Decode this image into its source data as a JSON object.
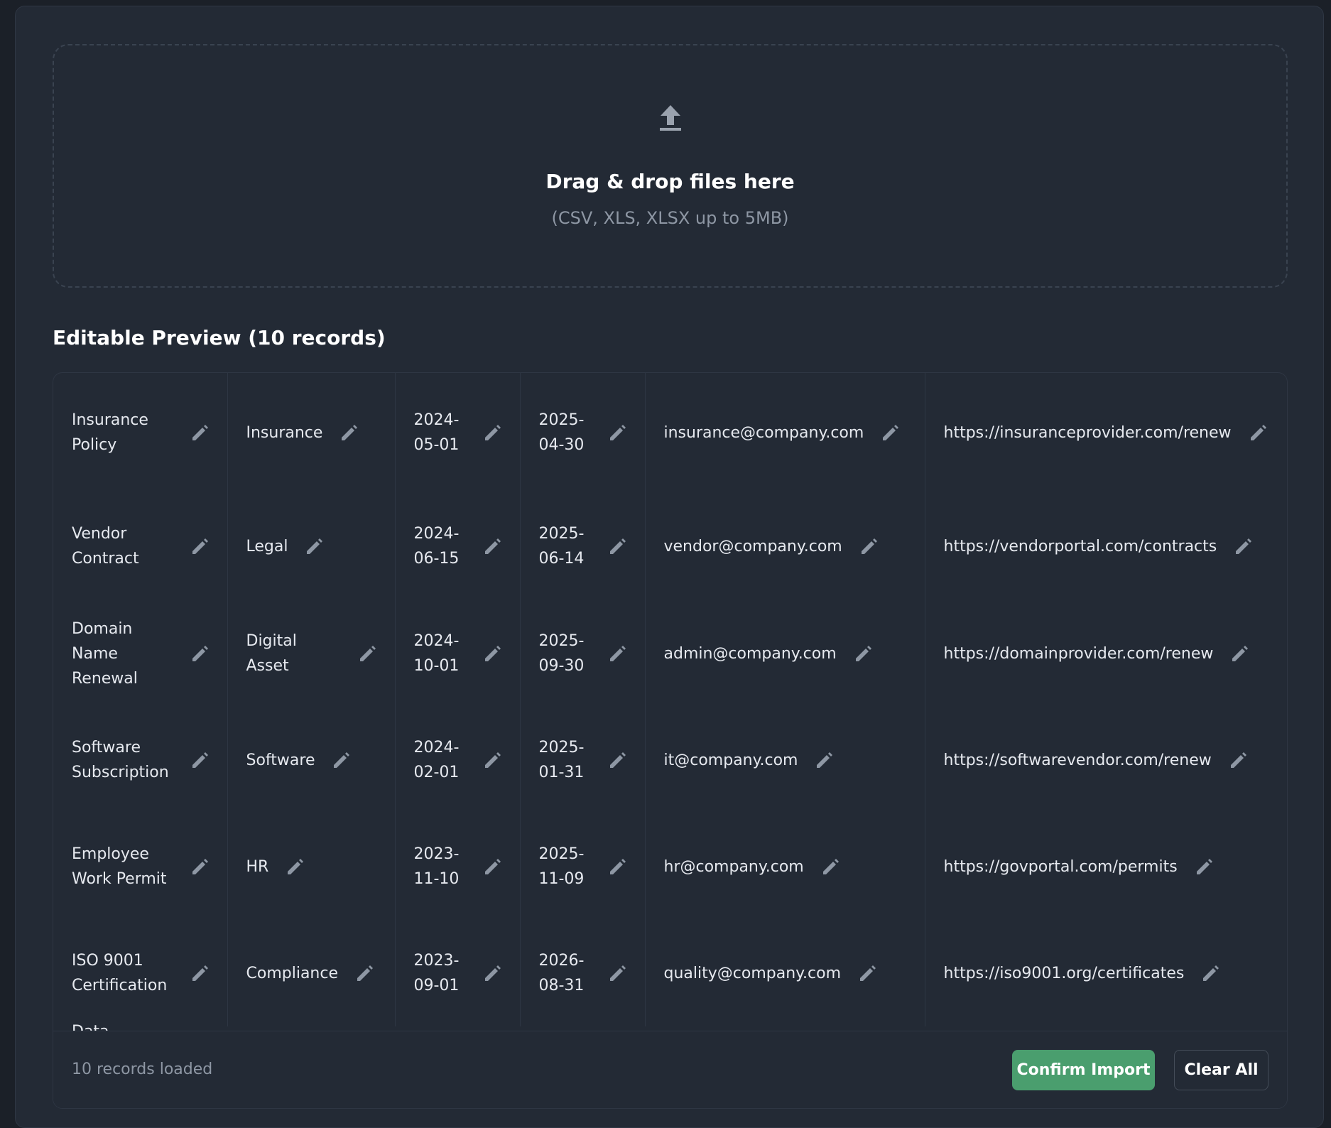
{
  "upload": {
    "icon": "upload-icon",
    "title": "Drag & drop files here",
    "subtitle": "(CSV, XLS, XLSX up to 5MB)"
  },
  "preview": {
    "title": "Editable Preview (10 records)",
    "rows": [
      {
        "name": "Insurance Policy",
        "category": "Insurance",
        "start": "2024-05-01",
        "end": "2025-04-30",
        "email": "insurance@company.com",
        "url": "https://insuranceprovider.com/renew"
      },
      {
        "name": "Vendor Contract",
        "category": "Legal",
        "start": "2024-06-15",
        "end": "2025-06-14",
        "email": "vendor@company.com",
        "url": "https://vendorportal.com/contracts"
      },
      {
        "name": "Domain Name Renewal",
        "category": "Digital Asset",
        "start": "2024-10-01",
        "end": "2025-09-30",
        "email": "admin@company.com",
        "url": "https://domainprovider.com/renew"
      },
      {
        "name": "Software Subscription",
        "category": "Software",
        "start": "2024-02-01",
        "end": "2025-01-31",
        "email": "it@company.com",
        "url": "https://softwarevendor.com/renew"
      },
      {
        "name": "Employee Work Permit",
        "category": "HR",
        "start": "2023-11-10",
        "end": "2025-11-09",
        "email": "hr@company.com",
        "url": "https://govportal.com/permits"
      },
      {
        "name": "ISO 9001 Certification",
        "category": "Compliance",
        "start": "2023-09-01",
        "end": "2026-08-31",
        "email": "quality@company.com",
        "url": "https://iso9001.org/certificates"
      }
    ],
    "partial_next_row": "Data"
  },
  "footer": {
    "records_loaded": "10 records loaded",
    "confirm_label": "Confirm Import",
    "clear_label": "Clear All"
  },
  "colors": {
    "background": "#1b2028",
    "panel": "#232a35",
    "accent_green": "#4a9e6e",
    "muted_text": "#8e97a4"
  }
}
